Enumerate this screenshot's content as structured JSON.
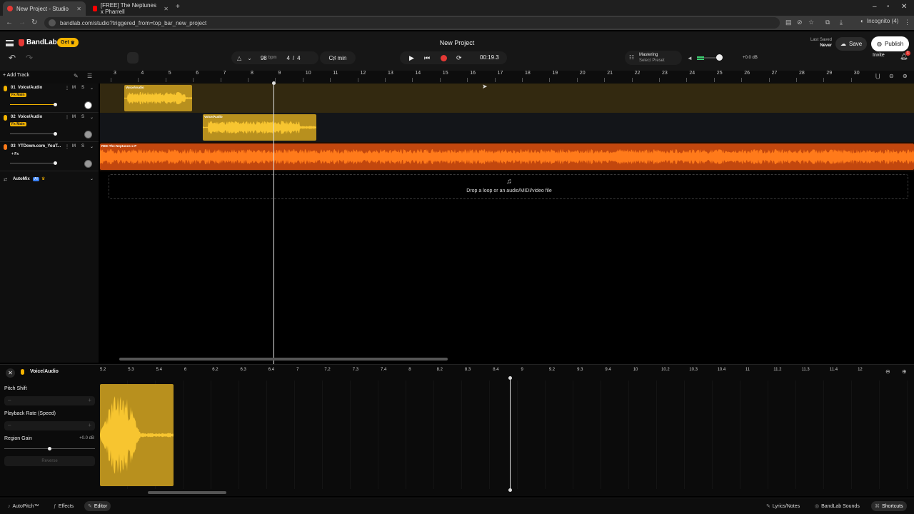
{
  "browser": {
    "tabs": [
      {
        "title": "New Project - Studio"
      },
      {
        "title": "[FREE] The Neptunes x Pharrell"
      }
    ],
    "url": "bandlab.com/studio?triggered_from=top_bar_new_project",
    "profile": "Incognito (4)"
  },
  "header": {
    "brand": "BandLab",
    "get_label": "Get",
    "project_title": "New Project",
    "last_saved_label": "Last Saved",
    "last_saved_value": "Never",
    "save_label": "Save",
    "publish_label": "Publish",
    "invite_label": "Invite",
    "notification_count": "1"
  },
  "toolbar": {
    "tempo": "98",
    "tempo_unit": "bpm",
    "time_sig_num": "4",
    "time_sig_sep": "/",
    "time_sig_den": "4",
    "key": "C♯ min",
    "time": "00:19.3",
    "mastering_label": "Mastering",
    "mastering_preset": "Select Preset",
    "master_volume": "+0.0 dB"
  },
  "ruler": {
    "add_track_label": "Add Track",
    "ticks": [
      "3",
      "4",
      "5",
      "6",
      "7",
      "8",
      "9",
      "10",
      "11",
      "12",
      "13",
      "14",
      "15",
      "16",
      "17",
      "18",
      "19",
      "20",
      "21",
      "22",
      "23",
      "24",
      "25",
      "26",
      "27",
      "28",
      "29",
      "30"
    ]
  },
  "tracks": [
    {
      "number": "01",
      "name": "Voice/Audio",
      "fx": "Fx Main",
      "mute": "M",
      "solo": "S",
      "region_label": "Voice/Audio"
    },
    {
      "number": "02",
      "name": "Voice/Audio",
      "fx": "Fx Main",
      "mute": "M",
      "solo": "S",
      "region_label": "Voice/Audio"
    },
    {
      "number": "03",
      "name": "YTDown.com_YouT...",
      "fx": "+ Fx",
      "mute": "M",
      "solo": "S",
      "region_label": "REE-The-Neptunes-x-P"
    }
  ],
  "automix": {
    "label": "AutoMix",
    "badge": "AI"
  },
  "dropzone": {
    "text": "Drop a loop or an audio/MIDI/video file"
  },
  "editor": {
    "title": "Voice/Audio",
    "ticks": [
      "5.2",
      "5.3",
      "5.4",
      "6",
      "6.2",
      "6.3",
      "6.4",
      "7",
      "7.2",
      "7.3",
      "7.4",
      "8",
      "8.2",
      "8.3",
      "8.4",
      "9",
      "9.2",
      "9.3",
      "9.4",
      "10",
      "10.2",
      "10.3",
      "10.4",
      "11",
      "11.2",
      "11.3",
      "11.4",
      "12"
    ],
    "pitch_shift_label": "Pitch Shift",
    "playback_rate_label": "Playback Rate (Speed)",
    "region_gain_label": "Region Gain",
    "region_gain_value": "+0.0 dB",
    "region_gain_level": 0.5,
    "reverse_label": "Reverse"
  },
  "bottombar": {
    "autopitch": "AutoPitch™",
    "effects": "Effects",
    "editor": "Editor",
    "lyrics": "Lyrics/Notes",
    "sounds": "BandLab Sounds",
    "shortcuts": "Shortcuts"
  },
  "colors": {
    "accent": "#f5b400",
    "record": "#e53935",
    "track_gold": "#b8901e",
    "track_orange": "#c2470e"
  }
}
